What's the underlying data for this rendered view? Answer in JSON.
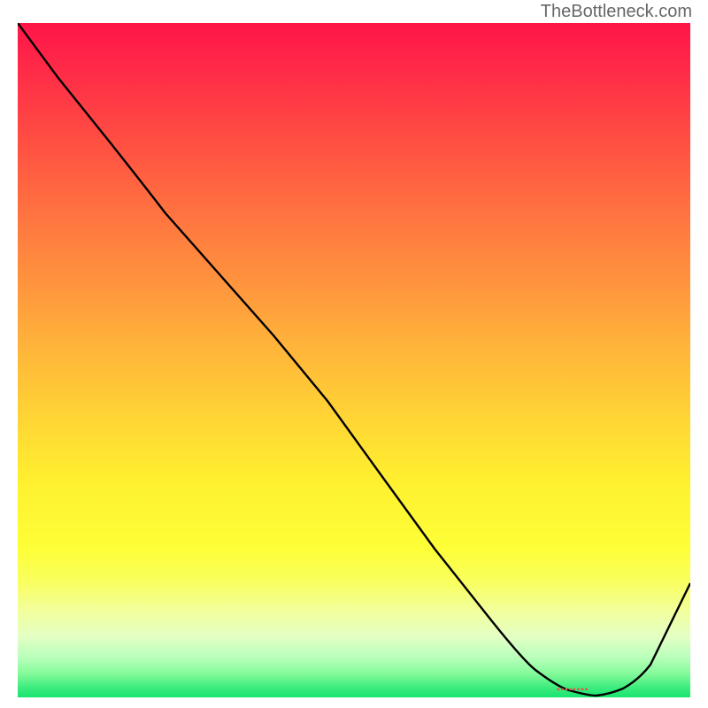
{
  "watermark": "TheBottleneck.com",
  "chart_data": {
    "type": "line",
    "title": "",
    "xlabel": "",
    "ylabel": "",
    "xlim": [
      0,
      100
    ],
    "ylim": [
      0,
      100
    ],
    "series": [
      {
        "name": "curve",
        "x": [
          0,
          6,
          14,
          22,
          30,
          38,
          46,
          54,
          62,
          70,
          77,
          82,
          86,
          90,
          94,
          100
        ],
        "y": [
          100,
          92,
          82,
          74,
          65,
          54,
          44,
          33,
          22,
          12,
          4,
          1,
          0,
          1,
          5,
          17
        ]
      }
    ],
    "marker": {
      "x": 84,
      "y": 0.5,
      "label": ""
    },
    "colors": {
      "gradient_top": "#ff1548",
      "gradient_mid": "#fff02f",
      "gradient_bottom": "#18e570",
      "line": "#000000",
      "marker": "#e4524a"
    }
  }
}
